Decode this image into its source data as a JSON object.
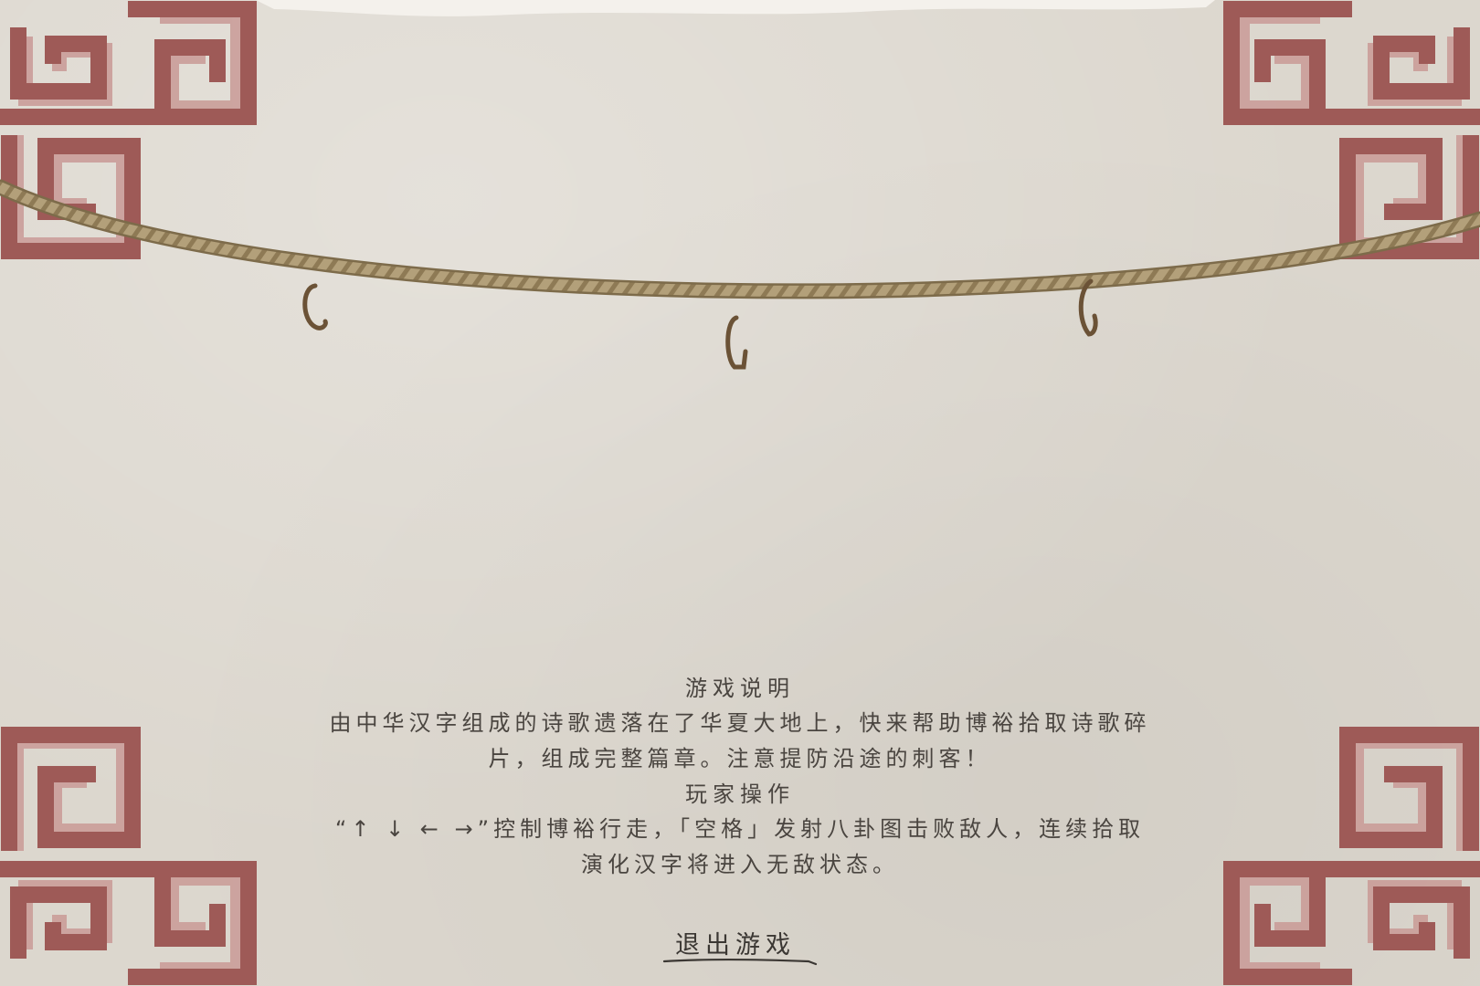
{
  "instructions": {
    "title": "游戏说明",
    "description_line1": "由中华汉字组成的诗歌遗落在了华夏大地上，快来帮助博裕拾取诗歌碎",
    "description_line2": "片，组成完整篇章。注意提防沿途的刺客！",
    "controls_title": "玩家操作",
    "controls_line1": "“↑ ↓ ← →”控制博裕行走，「空格」发射八卦图击败敌人，连续拾取",
    "controls_line2": "演化汉字将进入无敌状态。"
  },
  "exit_button": {
    "label": "退出游戏"
  },
  "colors": {
    "background": "#dcd7ce",
    "frame_red": "#9e5a57",
    "frame_light": "#c99a96",
    "rope": "#a8946a",
    "hook": "#6b5236",
    "text": "#4a4540"
  },
  "icons": [
    "rope",
    "hook",
    "corner-fret-pattern"
  ]
}
